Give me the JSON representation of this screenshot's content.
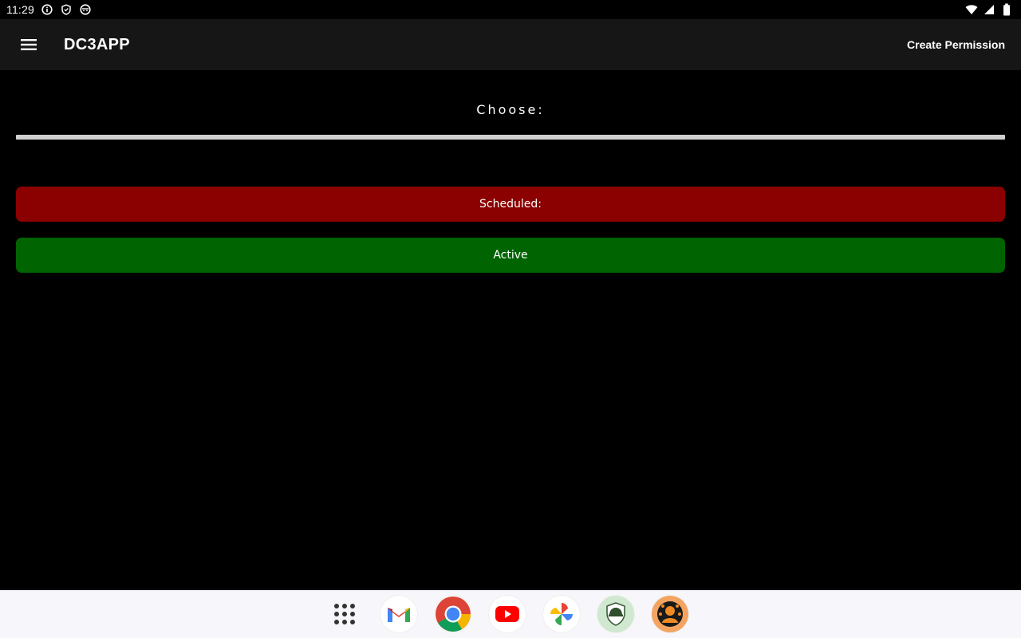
{
  "status_bar": {
    "time": "11:29",
    "left_icons": [
      "info-icon",
      "shield-icon",
      "face-icon"
    ],
    "right_icons": [
      "wifi-icon",
      "signal-icon",
      "battery-icon"
    ]
  },
  "app_bar": {
    "title": "DC3APP",
    "action_label": "Create Permission",
    "menu_icon": "hamburger-menu-icon"
  },
  "main": {
    "choose_label": "Choose:",
    "buttons": [
      {
        "label": "Scheduled:",
        "color": "#8b0000"
      },
      {
        "label": "Active",
        "color": "#006400"
      }
    ]
  },
  "dock": {
    "items": [
      "app-drawer-icon",
      "gmail-icon",
      "chrome-icon",
      "youtube-icon",
      "photos-icon",
      "helmet-app-icon",
      "orange-avatar-app-icon"
    ]
  },
  "colors": {
    "background": "#000000",
    "app_bar": "#161616",
    "scheduled": "#8b0000",
    "active": "#006400",
    "divider": "#d0d0d0",
    "dock": "#f7f7fb"
  }
}
